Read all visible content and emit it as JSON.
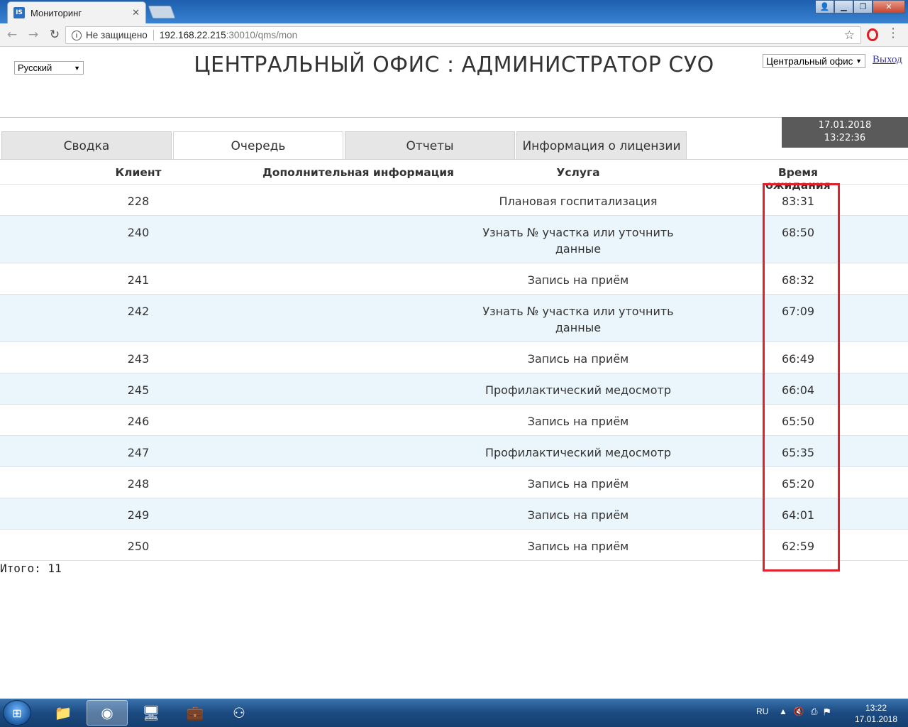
{
  "browser": {
    "tab_title": "Мониторинг",
    "tab_favicon_text": "IS",
    "security_label": "Не защищено",
    "url_host": "192.168.22.215",
    "url_rest": ":30010/qms/mon"
  },
  "header": {
    "language": "Русский",
    "title": "ЦЕНТРАЛЬНЫЙ ОФИС : АДМИНИСТРАТОР СУО",
    "office": "Центральный офис",
    "logout": "Выход",
    "date": "17.01.2018",
    "time": "13:22:36"
  },
  "tabs": [
    {
      "label": "Сводка"
    },
    {
      "label": "Очередь"
    },
    {
      "label": "Отчеты"
    },
    {
      "label": "Информация о лицензии"
    }
  ],
  "table": {
    "columns": [
      "Клиент",
      "Дополнительная информация",
      "Услуга",
      "Время ожидания"
    ],
    "rows": [
      {
        "client": "228",
        "info": "",
        "service": "Плановая госпитализация",
        "wait": "83:31"
      },
      {
        "client": "240",
        "info": "",
        "service": "Узнать № участка или уточнить данные",
        "wait": "68:50"
      },
      {
        "client": "241",
        "info": "",
        "service": "Запись на приём",
        "wait": "68:32"
      },
      {
        "client": "242",
        "info": "",
        "service": "Узнать № участка или уточнить данные",
        "wait": "67:09"
      },
      {
        "client": "243",
        "info": "",
        "service": "Запись на приём",
        "wait": "66:49"
      },
      {
        "client": "245",
        "info": "",
        "service": "Профилактический медосмотр",
        "wait": "66:04"
      },
      {
        "client": "246",
        "info": "",
        "service": "Запись на приём",
        "wait": "65:50"
      },
      {
        "client": "247",
        "info": "",
        "service": "Профилактический медосмотр",
        "wait": "65:35"
      },
      {
        "client": "248",
        "info": "",
        "service": "Запись на приём",
        "wait": "65:20"
      },
      {
        "client": "249",
        "info": "",
        "service": "Запись на приём",
        "wait": "64:01"
      },
      {
        "client": "250",
        "info": "",
        "service": "Запись на приём",
        "wait": "62:59"
      }
    ],
    "total": "Итого: 11"
  },
  "taskbar": {
    "lang": "RU",
    "time": "13:22",
    "date": "17.01.2018"
  },
  "colors": {
    "highlight": "#e0202a",
    "row_alt": "#eaf6fc",
    "clock_bg": "#5a5a5a"
  }
}
